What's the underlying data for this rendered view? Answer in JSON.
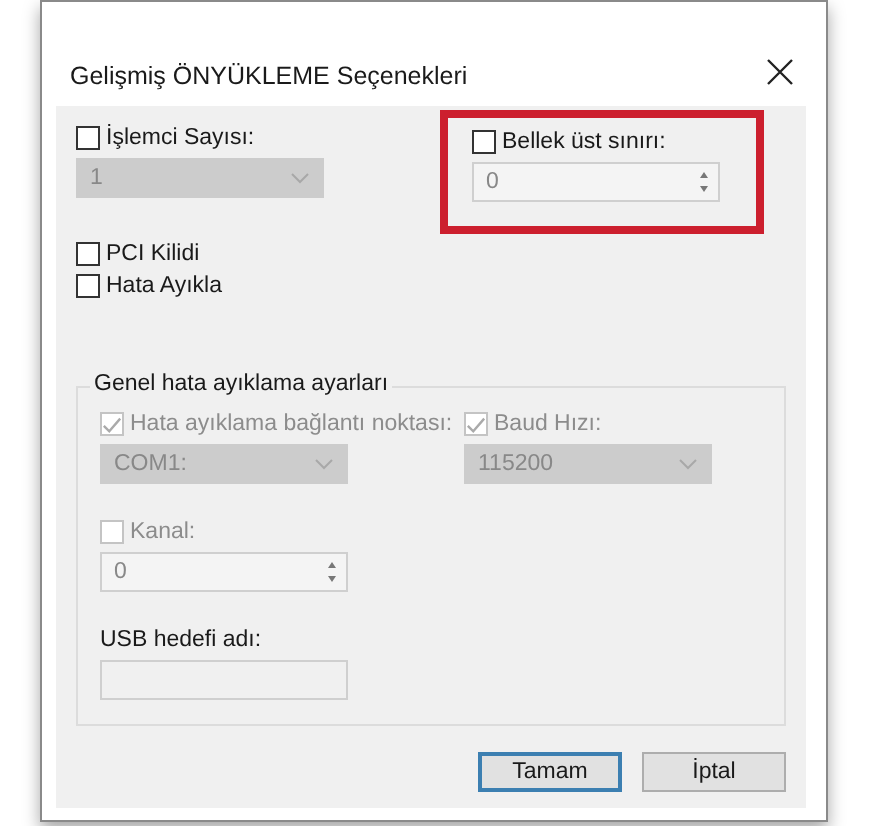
{
  "window": {
    "title": "Gelişmiş ÖNYÜKLEME Seçenekleri"
  },
  "processor": {
    "checkbox": {
      "label": "İşlemci Sayısı:",
      "checked": false,
      "disabled": false
    },
    "dropdown": {
      "value": "1",
      "disabled": true
    }
  },
  "memory": {
    "highlighted": true,
    "checkbox": {
      "label": "Bellek üst sınırı:",
      "checked": false,
      "disabled": false
    },
    "spinner": {
      "value": "0",
      "disabled": true
    }
  },
  "pci_lock": {
    "label": "PCI Kilidi",
    "checked": false,
    "disabled": false
  },
  "debug": {
    "label": "Hata Ayıkla",
    "checked": false,
    "disabled": false
  },
  "debug_settings": {
    "title": "Genel hata ayıklama ayarları",
    "port": {
      "checkbox": {
        "label": "Hata ayıklama bağlantı noktası:",
        "checked": true,
        "disabled": true
      },
      "dropdown": {
        "value": "COM1:",
        "disabled": true
      }
    },
    "baud": {
      "checkbox": {
        "label": "Baud Hızı:",
        "checked": true,
        "disabled": true
      },
      "dropdown": {
        "value": "115200",
        "disabled": true
      }
    },
    "channel": {
      "checkbox": {
        "label": "Kanal:",
        "checked": false,
        "disabled": true
      },
      "spinner": {
        "value": "0",
        "disabled": true
      }
    },
    "usb_target": {
      "label": "USB hedefi adı:",
      "disabled": true
    }
  },
  "buttons": [
    {
      "label": "Tamam",
      "default": true
    },
    {
      "label": "İptal",
      "default": false
    }
  ]
}
